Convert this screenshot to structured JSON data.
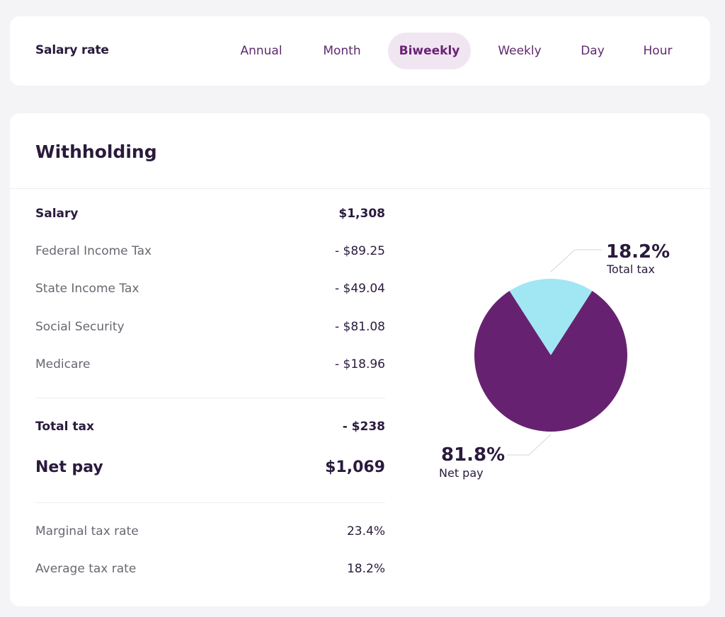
{
  "salary_rate": {
    "title": "Salary rate",
    "tabs": [
      {
        "label": "Annual",
        "active": false
      },
      {
        "label": "Month",
        "active": false
      },
      {
        "label": "Biweekly",
        "active": true
      },
      {
        "label": "Weekly",
        "active": false
      },
      {
        "label": "Day",
        "active": false
      },
      {
        "label": "Hour",
        "active": false
      }
    ]
  },
  "withholding": {
    "title": "Withholding",
    "salary": {
      "label": "Salary",
      "value": "$1,308"
    },
    "deductions": [
      {
        "label": "Federal Income Tax",
        "value": "- $89.25"
      },
      {
        "label": "State Income Tax",
        "value": "- $49.04"
      },
      {
        "label": "Social Security",
        "value": "- $81.08"
      },
      {
        "label": "Medicare",
        "value": "- $18.96"
      }
    ],
    "total_tax": {
      "label": "Total tax",
      "value": "- $238"
    },
    "net_pay": {
      "label": "Net pay",
      "value": "$1,069"
    },
    "rates": [
      {
        "label": "Marginal tax rate",
        "value": "23.4%"
      },
      {
        "label": "Average tax rate",
        "value": "18.2%"
      }
    ]
  },
  "colors": {
    "accent": "#662270",
    "tax_slice": "#a0e7f3",
    "active_tab_bg": "#f0e6f1",
    "text_dark": "#2a1a3d"
  },
  "chart_data": {
    "type": "pie",
    "title": "",
    "slices": [
      {
        "name": "Total tax",
        "value": 18.2,
        "label": "18.2%",
        "color": "#a0e7f3"
      },
      {
        "name": "Net pay",
        "value": 81.8,
        "label": "81.8%",
        "color": "#662270"
      }
    ],
    "legend": "none",
    "annotations": [
      "18.2%",
      "Total tax",
      "81.8%",
      "Net pay"
    ]
  }
}
